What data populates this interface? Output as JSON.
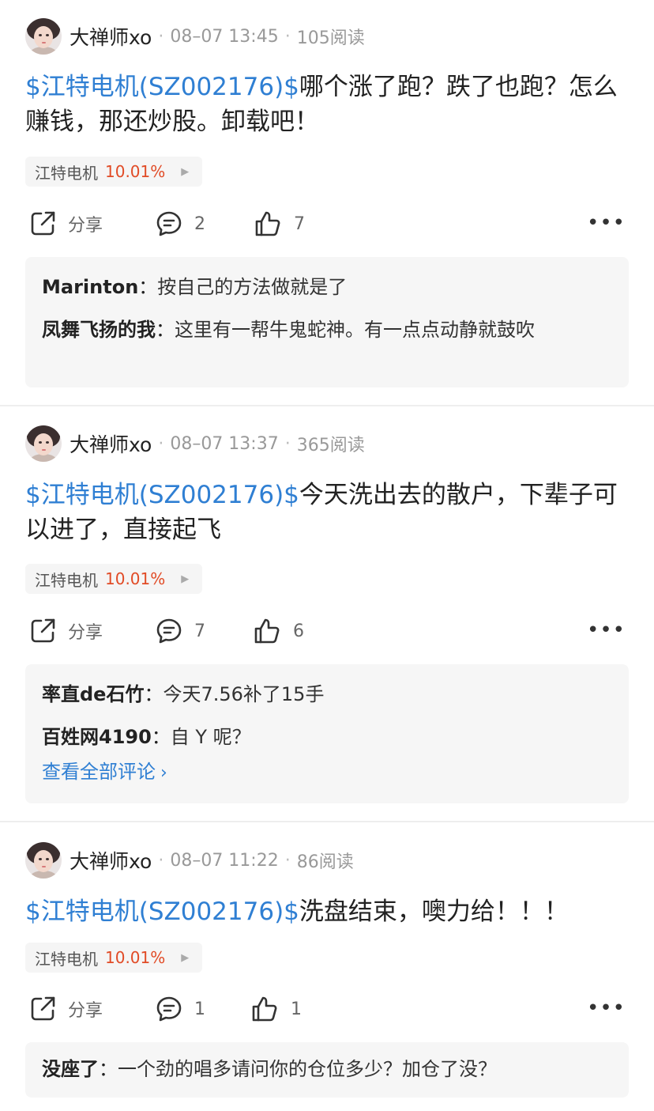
{
  "posts": [
    {
      "author": "大禅师xo",
      "time": "08–07 13:45",
      "reads": "105阅读",
      "stock_link": "$江特电机(SZ002176)$",
      "text": "哪个涨了跑？跌了也跑？怎么赚钱，那还炒股。卸载吧！",
      "tag_name": "江特电机",
      "tag_pct": "10.01%",
      "share_label": "分享",
      "comment_count": "2",
      "like_count": "7",
      "comments": [
        {
          "user": "Marinton",
          "text": "按自己的方法做就是了"
        },
        {
          "user": "凤舞飞扬的我",
          "text": "这里有一帮牛鬼蛇神。有一点点动静就鼓吹"
        }
      ]
    },
    {
      "author": "大禅师xo",
      "time": "08–07 13:37",
      "reads": "365阅读",
      "stock_link": "$江特电机(SZ002176)$",
      "text": "今天洗出去的散户，下辈子可以进了，直接起飞",
      "tag_name": "江特电机",
      "tag_pct": "10.01%",
      "share_label": "分享",
      "comment_count": "7",
      "like_count": "6",
      "comments": [
        {
          "user": "率直de石竹",
          "text": "今天7.56补了15手"
        },
        {
          "user": "百姓网4190",
          "text": "自 Y 呢？"
        }
      ],
      "view_all": "查看全部评论"
    },
    {
      "author": "大禅师xo",
      "time": "08–07 11:22",
      "reads": "86阅读",
      "stock_link": "$江特电机(SZ002176)$",
      "text": "洗盘结束，噢力给！！！",
      "tag_name": "江特电机",
      "tag_pct": "10.01%",
      "share_label": "分享",
      "comment_count": "1",
      "like_count": "1",
      "comments": [
        {
          "user": "没座了",
          "text": "一个劲的唱多请问你的仓位多少？加仓了没？"
        }
      ]
    }
  ],
  "colors": {
    "link": "#2f7fd3",
    "rise": "#e14b26"
  },
  "icons": [
    "share-icon",
    "comment-icon",
    "like-icon",
    "more-icon",
    "caret-right-icon",
    "chevron-right-icon"
  ]
}
